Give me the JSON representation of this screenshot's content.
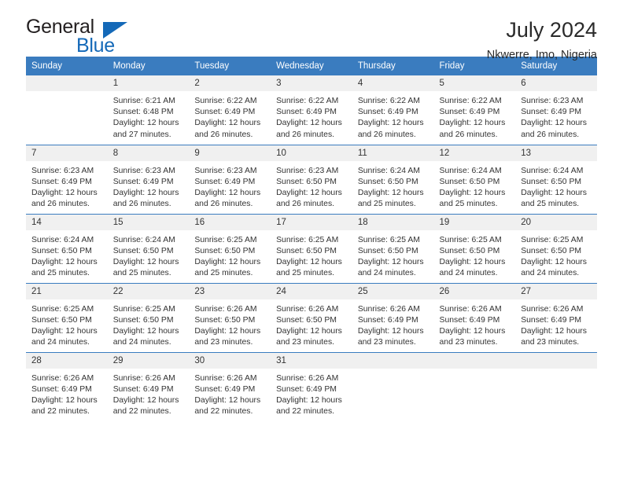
{
  "brand": {
    "name_top": "General",
    "name_bottom": "Blue",
    "accent_color": "#1469b8",
    "triangle_icon": "triangle-icon"
  },
  "header": {
    "title": "July 2024",
    "subtitle": "Nkwerre, Imo, Nigeria"
  },
  "theme": {
    "header_blue": "#3a7cbf",
    "daynum_gray": "#f0f0f0",
    "text_color": "#333333"
  },
  "weekday_headers": [
    "Sunday",
    "Monday",
    "Tuesday",
    "Wednesday",
    "Thursday",
    "Friday",
    "Saturday"
  ],
  "labels": {
    "sunrise_prefix": "Sunrise:",
    "sunset_prefix": "Sunset:",
    "daylight_prefix": "Daylight:"
  },
  "weeks": [
    [
      {
        "day": "",
        "blank": true,
        "sunrise": "",
        "sunset": "",
        "daylight_line1": "",
        "daylight_line2": ""
      },
      {
        "day": "1",
        "sunrise": "Sunrise: 6:21 AM",
        "sunset": "Sunset: 6:48 PM",
        "daylight_line1": "Daylight: 12 hours",
        "daylight_line2": "and 27 minutes."
      },
      {
        "day": "2",
        "sunrise": "Sunrise: 6:22 AM",
        "sunset": "Sunset: 6:49 PM",
        "daylight_line1": "Daylight: 12 hours",
        "daylight_line2": "and 26 minutes."
      },
      {
        "day": "3",
        "sunrise": "Sunrise: 6:22 AM",
        "sunset": "Sunset: 6:49 PM",
        "daylight_line1": "Daylight: 12 hours",
        "daylight_line2": "and 26 minutes."
      },
      {
        "day": "4",
        "sunrise": "Sunrise: 6:22 AM",
        "sunset": "Sunset: 6:49 PM",
        "daylight_line1": "Daylight: 12 hours",
        "daylight_line2": "and 26 minutes."
      },
      {
        "day": "5",
        "sunrise": "Sunrise: 6:22 AM",
        "sunset": "Sunset: 6:49 PM",
        "daylight_line1": "Daylight: 12 hours",
        "daylight_line2": "and 26 minutes."
      },
      {
        "day": "6",
        "sunrise": "Sunrise: 6:23 AM",
        "sunset": "Sunset: 6:49 PM",
        "daylight_line1": "Daylight: 12 hours",
        "daylight_line2": "and 26 minutes."
      }
    ],
    [
      {
        "day": "7",
        "sunrise": "Sunrise: 6:23 AM",
        "sunset": "Sunset: 6:49 PM",
        "daylight_line1": "Daylight: 12 hours",
        "daylight_line2": "and 26 minutes."
      },
      {
        "day": "8",
        "sunrise": "Sunrise: 6:23 AM",
        "sunset": "Sunset: 6:49 PM",
        "daylight_line1": "Daylight: 12 hours",
        "daylight_line2": "and 26 minutes."
      },
      {
        "day": "9",
        "sunrise": "Sunrise: 6:23 AM",
        "sunset": "Sunset: 6:49 PM",
        "daylight_line1": "Daylight: 12 hours",
        "daylight_line2": "and 26 minutes."
      },
      {
        "day": "10",
        "sunrise": "Sunrise: 6:23 AM",
        "sunset": "Sunset: 6:50 PM",
        "daylight_line1": "Daylight: 12 hours",
        "daylight_line2": "and 26 minutes."
      },
      {
        "day": "11",
        "sunrise": "Sunrise: 6:24 AM",
        "sunset": "Sunset: 6:50 PM",
        "daylight_line1": "Daylight: 12 hours",
        "daylight_line2": "and 25 minutes."
      },
      {
        "day": "12",
        "sunrise": "Sunrise: 6:24 AM",
        "sunset": "Sunset: 6:50 PM",
        "daylight_line1": "Daylight: 12 hours",
        "daylight_line2": "and 25 minutes."
      },
      {
        "day": "13",
        "sunrise": "Sunrise: 6:24 AM",
        "sunset": "Sunset: 6:50 PM",
        "daylight_line1": "Daylight: 12 hours",
        "daylight_line2": "and 25 minutes."
      }
    ],
    [
      {
        "day": "14",
        "sunrise": "Sunrise: 6:24 AM",
        "sunset": "Sunset: 6:50 PM",
        "daylight_line1": "Daylight: 12 hours",
        "daylight_line2": "and 25 minutes."
      },
      {
        "day": "15",
        "sunrise": "Sunrise: 6:24 AM",
        "sunset": "Sunset: 6:50 PM",
        "daylight_line1": "Daylight: 12 hours",
        "daylight_line2": "and 25 minutes."
      },
      {
        "day": "16",
        "sunrise": "Sunrise: 6:25 AM",
        "sunset": "Sunset: 6:50 PM",
        "daylight_line1": "Daylight: 12 hours",
        "daylight_line2": "and 25 minutes."
      },
      {
        "day": "17",
        "sunrise": "Sunrise: 6:25 AM",
        "sunset": "Sunset: 6:50 PM",
        "daylight_line1": "Daylight: 12 hours",
        "daylight_line2": "and 25 minutes."
      },
      {
        "day": "18",
        "sunrise": "Sunrise: 6:25 AM",
        "sunset": "Sunset: 6:50 PM",
        "daylight_line1": "Daylight: 12 hours",
        "daylight_line2": "and 24 minutes."
      },
      {
        "day": "19",
        "sunrise": "Sunrise: 6:25 AM",
        "sunset": "Sunset: 6:50 PM",
        "daylight_line1": "Daylight: 12 hours",
        "daylight_line2": "and 24 minutes."
      },
      {
        "day": "20",
        "sunrise": "Sunrise: 6:25 AM",
        "sunset": "Sunset: 6:50 PM",
        "daylight_line1": "Daylight: 12 hours",
        "daylight_line2": "and 24 minutes."
      }
    ],
    [
      {
        "day": "21",
        "sunrise": "Sunrise: 6:25 AM",
        "sunset": "Sunset: 6:50 PM",
        "daylight_line1": "Daylight: 12 hours",
        "daylight_line2": "and 24 minutes."
      },
      {
        "day": "22",
        "sunrise": "Sunrise: 6:25 AM",
        "sunset": "Sunset: 6:50 PM",
        "daylight_line1": "Daylight: 12 hours",
        "daylight_line2": "and 24 minutes."
      },
      {
        "day": "23",
        "sunrise": "Sunrise: 6:26 AM",
        "sunset": "Sunset: 6:50 PM",
        "daylight_line1": "Daylight: 12 hours",
        "daylight_line2": "and 23 minutes."
      },
      {
        "day": "24",
        "sunrise": "Sunrise: 6:26 AM",
        "sunset": "Sunset: 6:50 PM",
        "daylight_line1": "Daylight: 12 hours",
        "daylight_line2": "and 23 minutes."
      },
      {
        "day": "25",
        "sunrise": "Sunrise: 6:26 AM",
        "sunset": "Sunset: 6:49 PM",
        "daylight_line1": "Daylight: 12 hours",
        "daylight_line2": "and 23 minutes."
      },
      {
        "day": "26",
        "sunrise": "Sunrise: 6:26 AM",
        "sunset": "Sunset: 6:49 PM",
        "daylight_line1": "Daylight: 12 hours",
        "daylight_line2": "and 23 minutes."
      },
      {
        "day": "27",
        "sunrise": "Sunrise: 6:26 AM",
        "sunset": "Sunset: 6:49 PM",
        "daylight_line1": "Daylight: 12 hours",
        "daylight_line2": "and 23 minutes."
      }
    ],
    [
      {
        "day": "28",
        "sunrise": "Sunrise: 6:26 AM",
        "sunset": "Sunset: 6:49 PM",
        "daylight_line1": "Daylight: 12 hours",
        "daylight_line2": "and 22 minutes."
      },
      {
        "day": "29",
        "sunrise": "Sunrise: 6:26 AM",
        "sunset": "Sunset: 6:49 PM",
        "daylight_line1": "Daylight: 12 hours",
        "daylight_line2": "and 22 minutes."
      },
      {
        "day": "30",
        "sunrise": "Sunrise: 6:26 AM",
        "sunset": "Sunset: 6:49 PM",
        "daylight_line1": "Daylight: 12 hours",
        "daylight_line2": "and 22 minutes."
      },
      {
        "day": "31",
        "sunrise": "Sunrise: 6:26 AM",
        "sunset": "Sunset: 6:49 PM",
        "daylight_line1": "Daylight: 12 hours",
        "daylight_line2": "and 22 minutes."
      },
      {
        "day": "",
        "blank": true,
        "sunrise": "",
        "sunset": "",
        "daylight_line1": "",
        "daylight_line2": ""
      },
      {
        "day": "",
        "blank": true,
        "sunrise": "",
        "sunset": "",
        "daylight_line1": "",
        "daylight_line2": ""
      },
      {
        "day": "",
        "blank": true,
        "sunrise": "",
        "sunset": "",
        "daylight_line1": "",
        "daylight_line2": ""
      }
    ]
  ]
}
